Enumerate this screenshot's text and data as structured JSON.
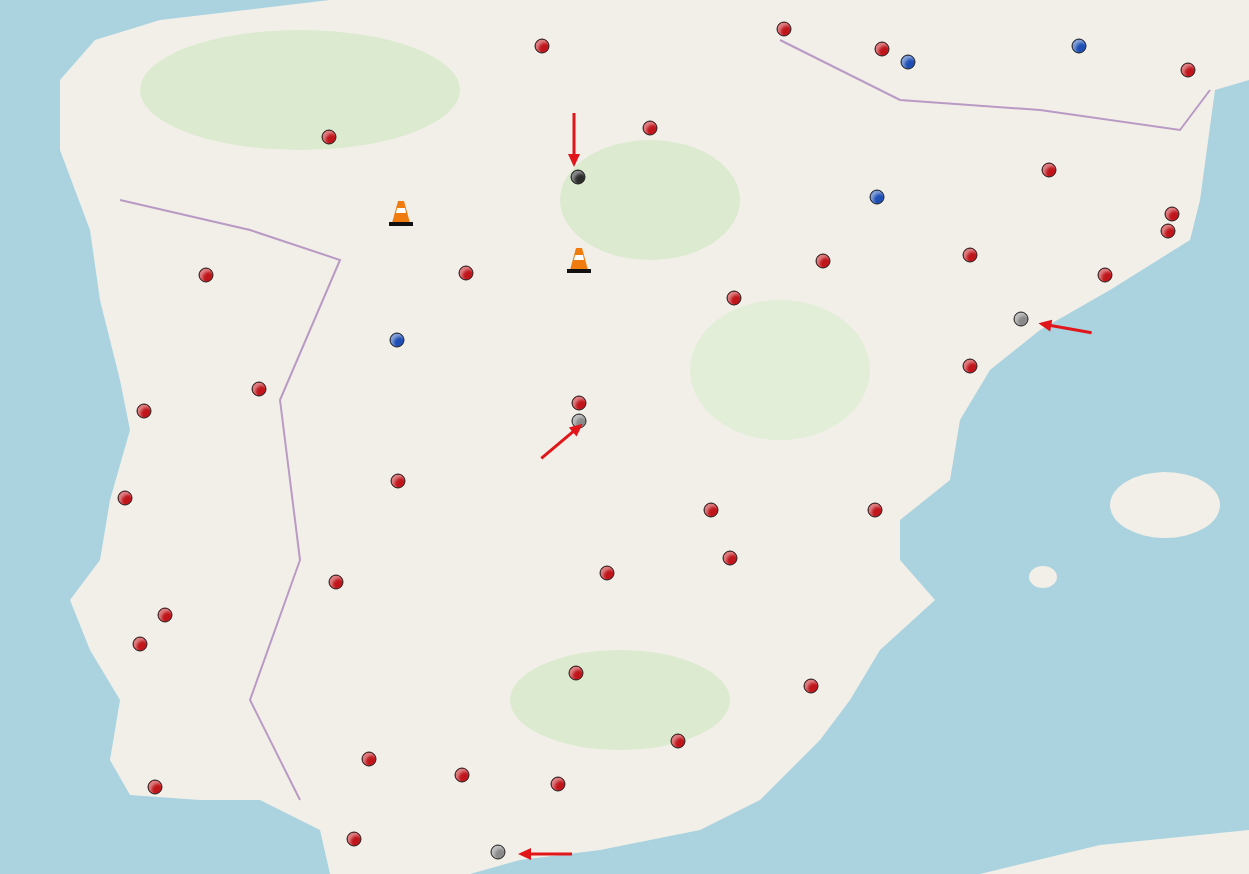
{
  "map": {
    "markers": [
      {
        "kind": "dot",
        "color": "#c0161b"
      },
      {
        "kind": "dot",
        "color": "#c0161b"
      },
      {
        "kind": "dot",
        "color": "#c0161b"
      },
      {
        "kind": "dot",
        "color": "#c0161b"
      },
      {
        "kind": "dot",
        "color": "#c0161b"
      },
      {
        "kind": "dot",
        "color": "#c0161b"
      },
      {
        "kind": "dot",
        "color": "#c0161b"
      },
      {
        "kind": "dot",
        "color": "#c0161b"
      },
      {
        "kind": "dot",
        "color": "#c0161b"
      },
      {
        "kind": "dot",
        "color": "#c0161b"
      },
      {
        "kind": "dot",
        "color": "#c0161b"
      },
      {
        "kind": "dot",
        "color": "#c0161b"
      },
      {
        "kind": "dot",
        "color": "#c0161b"
      },
      {
        "kind": "dot",
        "color": "#c0161b"
      },
      {
        "kind": "dot",
        "color": "#c0161b"
      },
      {
        "kind": "dot",
        "color": "#c0161b"
      },
      {
        "kind": "dot",
        "color": "#c0161b"
      },
      {
        "kind": "dot",
        "color": "#c0161b"
      },
      {
        "kind": "dot",
        "color": "#c0161b"
      },
      {
        "kind": "dot",
        "color": "#c0161b"
      },
      {
        "kind": "dot",
        "color": "#c0161b"
      },
      {
        "kind": "dot",
        "color": "#c0161b"
      },
      {
        "kind": "dot",
        "color": "#c0161b"
      },
      {
        "kind": "dot",
        "color": "#c0161b"
      },
      {
        "kind": "dot",
        "color": "#c0161b"
      },
      {
        "kind": "dot",
        "color": "#c0161b"
      },
      {
        "kind": "dot",
        "color": "#c0161b"
      },
      {
        "kind": "dot",
        "color": "#c0161b"
      },
      {
        "kind": "dot",
        "color": "#c0161b"
      },
      {
        "kind": "dot",
        "color": "#c0161b"
      },
      {
        "kind": "dot",
        "color": "#c0161b"
      },
      {
        "kind": "dot",
        "color": "#c0161b"
      },
      {
        "kind": "dot",
        "color": "#c0161b"
      },
      {
        "kind": "dot",
        "color": "#c0161b"
      },
      {
        "kind": "dot",
        "color": "#c0161b"
      },
      {
        "kind": "dot",
        "color": "#c0161b"
      },
      {
        "kind": "dot",
        "color": "#2b2b2b"
      },
      {
        "kind": "dot",
        "color": "#1f4fb5"
      },
      {
        "kind": "dot",
        "color": "#1f4fb5"
      },
      {
        "kind": "dot",
        "color": "#1f4fb5"
      },
      {
        "kind": "dot",
        "color": "#1f4fb5"
      },
      {
        "kind": "dot",
        "color": "#8a8a8a"
      },
      {
        "kind": "dot",
        "color": "#8a8a8a"
      },
      {
        "kind": "dot",
        "color": "#8a8a8a"
      },
      {
        "kind": "cone"
      },
      {
        "kind": "cone"
      },
      {
        "kind": "arrow"
      },
      {
        "kind": "arrow"
      },
      {
        "kind": "arrow"
      },
      {
        "kind": "arrow"
      }
    ]
  }
}
